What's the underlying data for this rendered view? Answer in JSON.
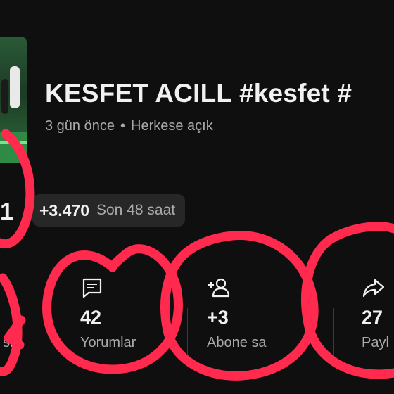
{
  "video": {
    "title": "KESFET ACILL #kesfet #",
    "age": "3 gün önce",
    "separator": "•",
    "visibility": "Herkese açık"
  },
  "views_partial": "1",
  "growth": {
    "value": "+3.470",
    "label": "Son 48 saat"
  },
  "stats": {
    "left_label_partial": "sı",
    "comments": {
      "value": "42",
      "label": "Yorumlar",
      "icon": "comment-icon"
    },
    "subscribers": {
      "value": "+3",
      "label": "Abone sa",
      "icon": "add-person-icon"
    },
    "shares": {
      "value": "27",
      "label": "Payl",
      "icon": "share-icon"
    }
  },
  "colors": {
    "background": "#0f0f0f",
    "muted": "#aaaaaa",
    "chip": "#272727",
    "annotation": "#ff2a4d"
  }
}
